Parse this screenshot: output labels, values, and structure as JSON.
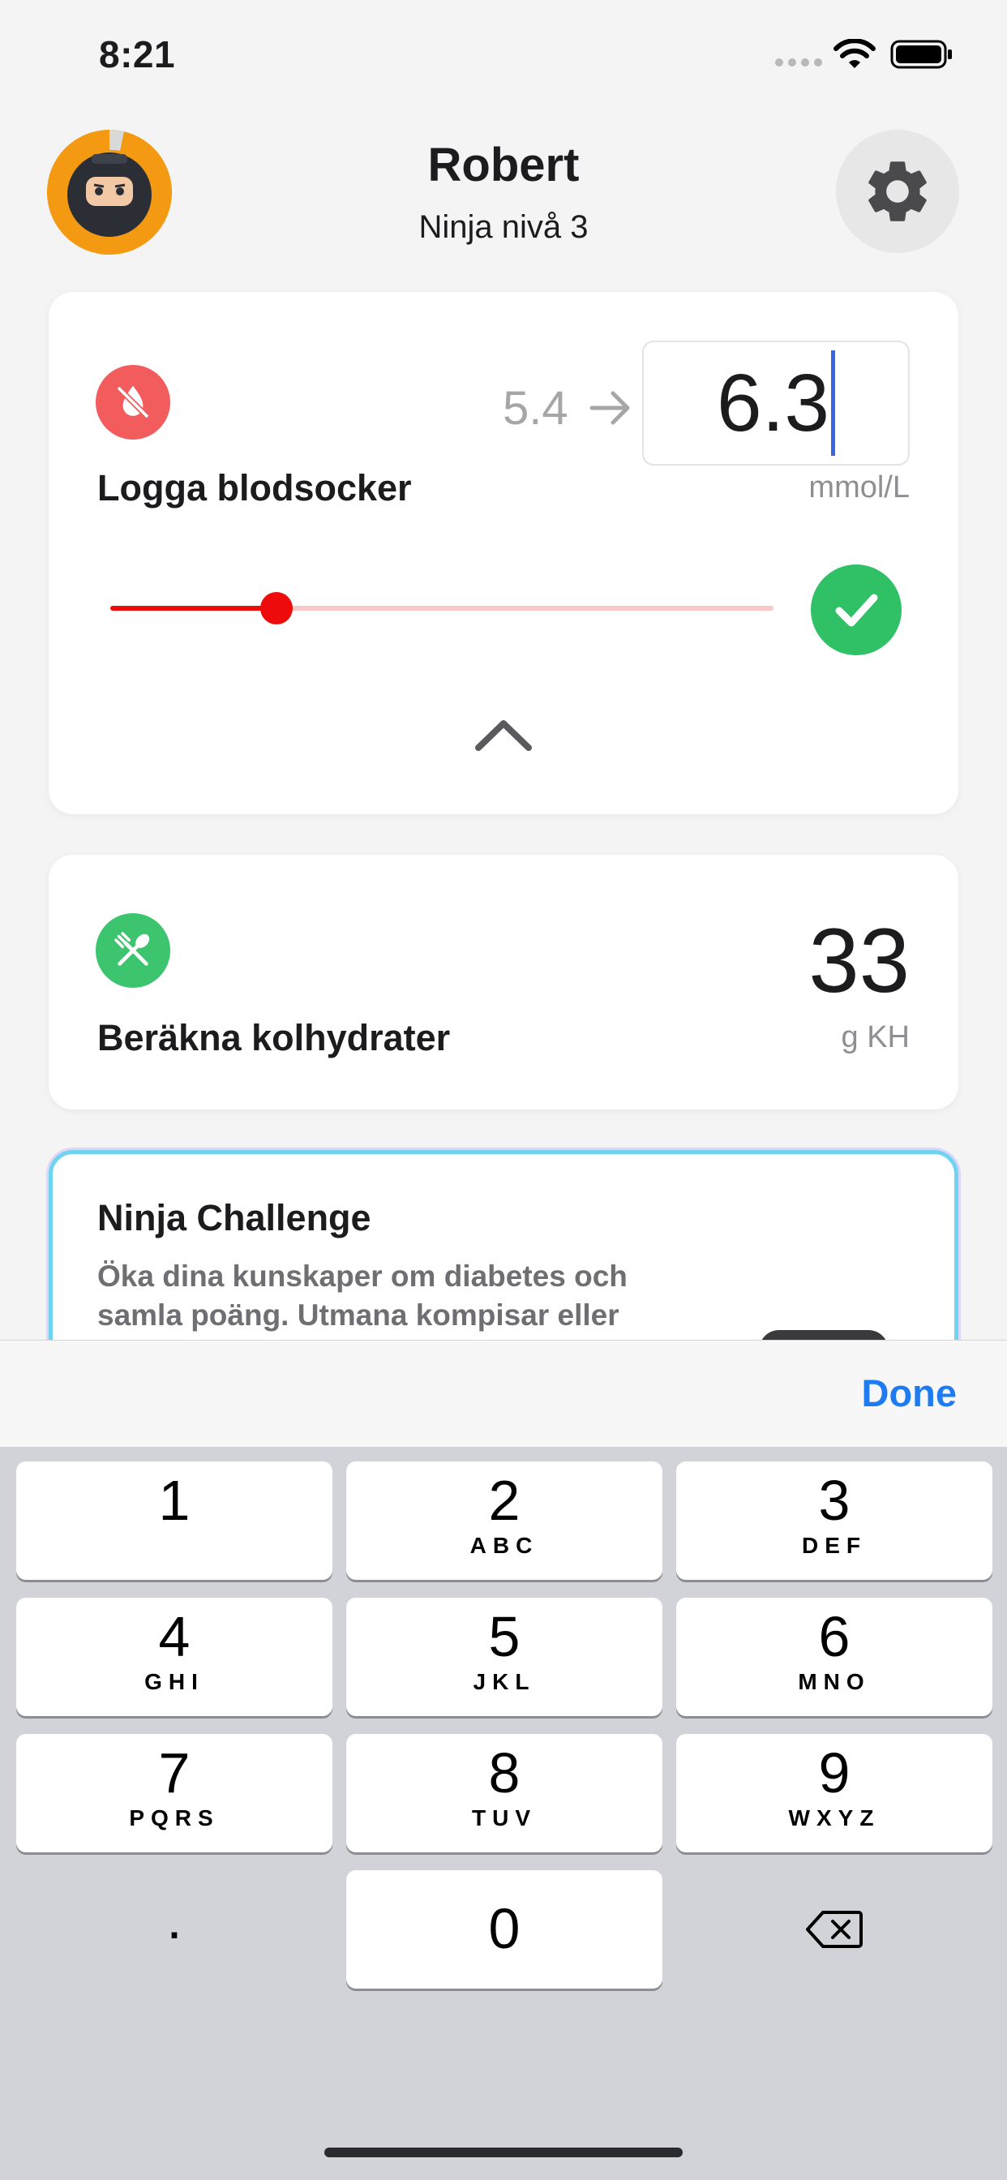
{
  "status_bar": {
    "time": "8:21"
  },
  "header": {
    "name": "Robert",
    "level": "Ninja nivå 3"
  },
  "blood_sugar_card": {
    "title": "Logga blodsocker",
    "previous_value": "5.4",
    "input_value": "6.3",
    "unit": "mmol/L",
    "slider_fraction": 0.25
  },
  "carb_card": {
    "title": "Beräkna kolhydrater",
    "value": "33",
    "unit": "g KH"
  },
  "challenge_card": {
    "title": "Ninja Challenge",
    "description": "Öka dina kunskaper om diabetes och samla poäng. Utmana kompisar eller"
  },
  "keyboard": {
    "done_label": "Done",
    "keys": [
      {
        "digit": "1",
        "letters": ""
      },
      {
        "digit": "2",
        "letters": "ABC"
      },
      {
        "digit": "3",
        "letters": "DEF"
      },
      {
        "digit": "4",
        "letters": "GHI"
      },
      {
        "digit": "5",
        "letters": "JKL"
      },
      {
        "digit": "6",
        "letters": "MNO"
      },
      {
        "digit": "7",
        "letters": "PQRS"
      },
      {
        "digit": "8",
        "letters": "TUV"
      },
      {
        "digit": "9",
        "letters": "WXYZ"
      }
    ],
    "zero": "0",
    "decimal": "."
  },
  "colors": {
    "accent": "#1f7bf2",
    "slider_red": "#ee0b0b",
    "confirm_green": "#30c066",
    "blood_sugar_icon": "#f35c5c",
    "carb_icon": "#3cc46e",
    "avatar_bg": "#f39a12"
  },
  "icons": {
    "settings": "gear-icon",
    "blood_sugar": "blood-drop-off-icon",
    "carbs": "fork-spoon-icon",
    "confirm": "checkmark-icon",
    "collapse": "chevron-up-icon",
    "backspace": "backspace-icon"
  }
}
